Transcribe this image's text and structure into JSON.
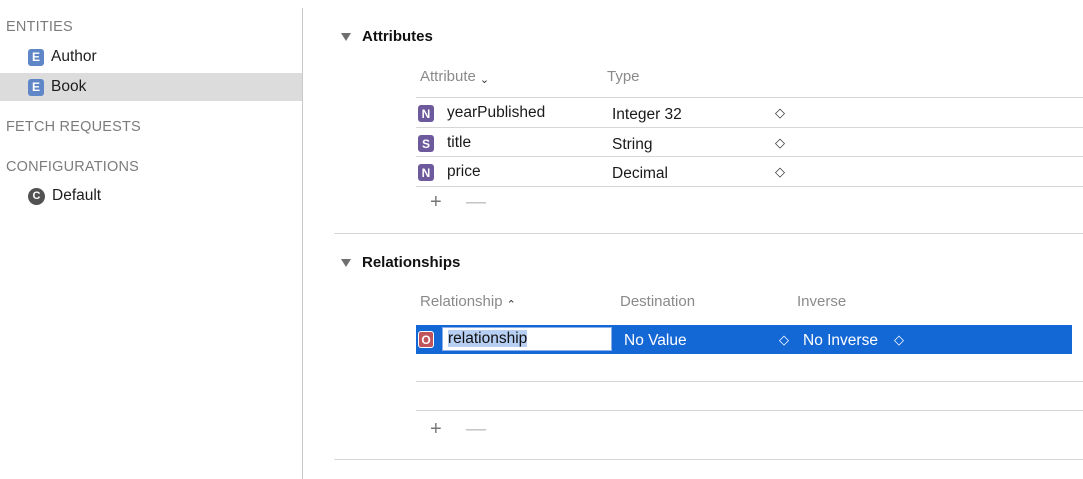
{
  "sidebar": {
    "entities_header": "ENTITIES",
    "entities": [
      {
        "badge": "E",
        "label": "Author",
        "selected": false
      },
      {
        "badge": "E",
        "label": "Book",
        "selected": true
      }
    ],
    "fetch_requests_header": "FETCH REQUESTS",
    "configurations_header": "CONFIGURATIONS",
    "configurations": [
      {
        "badge": "C",
        "label": "Default"
      }
    ]
  },
  "attributes": {
    "title": "Attributes",
    "col_attribute": "Attribute",
    "col_type": "Type",
    "rows": [
      {
        "badge": "N",
        "name": "yearPublished",
        "type": "Integer 32"
      },
      {
        "badge": "S",
        "name": "title",
        "type": "String"
      },
      {
        "badge": "N",
        "name": "price",
        "type": "Decimal"
      }
    ],
    "add_label": "+",
    "remove_label": "—"
  },
  "relationships": {
    "title": "Relationships",
    "col_relationship": "Relationship",
    "col_destination": "Destination",
    "col_inverse": "Inverse",
    "rows": [
      {
        "badge": "O",
        "name": "relationship",
        "destination": "No Value",
        "inverse": "No Inverse"
      }
    ],
    "add_label": "+",
    "remove_label": "—"
  },
  "glyphs": {
    "sort_desc": "⌄",
    "sort_asc": "⌃",
    "stepper": "◇"
  },
  "colors": {
    "selection_blue": "#1368d6",
    "entity_badge": "#5f86c6",
    "attr_badge": "#6c5a9c",
    "rel_badge": "#c0545a"
  }
}
